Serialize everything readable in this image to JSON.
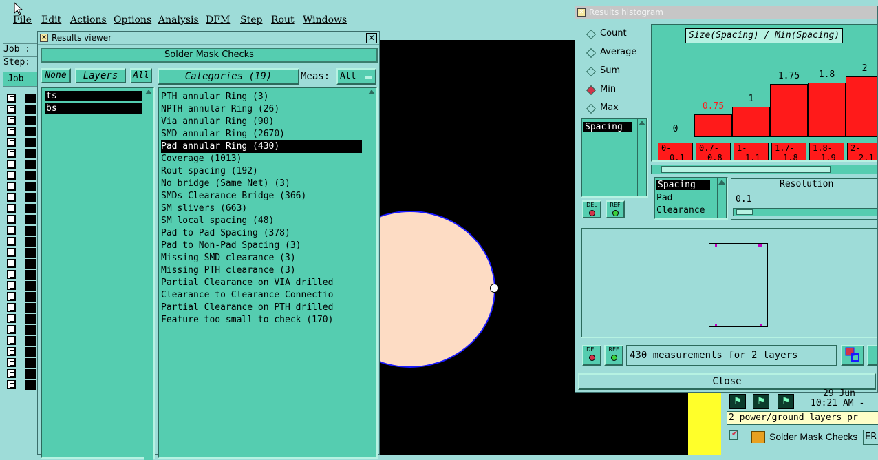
{
  "menu": {
    "items": [
      "File",
      "Edit",
      "Actions",
      "Options",
      "Analysis",
      "DFM",
      "Step",
      "Rout",
      "Windows"
    ]
  },
  "left_strip": {
    "job_label": "Job :",
    "step_label": "Step:",
    "job_button": "Job"
  },
  "results_viewer": {
    "title": "Results viewer",
    "header": "Solder Mask Checks",
    "none_button": "None",
    "layers_button": "Layers",
    "all_button": "All",
    "categories_button": "Categories (19)",
    "meas_label": "Meas:",
    "meas_value": "All",
    "layers": [
      "ts",
      "bs"
    ],
    "categories": [
      "PTH annular Ring (3)",
      "NPTH annular Ring (26)",
      "Via annular Ring (90)",
      "SMD annular Ring (2670)",
      "Pad annular Ring (430)",
      "Coverage (1013)",
      "Rout spacing (192)",
      "No bridge (Same Net) (3)",
      "SMDs Clearance Bridge (366)",
      "SM slivers (663)",
      "SM local spacing (48)",
      "Pad to Pad Spacing (378)",
      "Pad to Non-Pad Spacing (3)",
      "Missing SMD clearance (3)",
      "Missing PTH clearance (3)",
      "Partial Clearance on VIA drilled",
      "Clearance to Clearance Connectio",
      "Partial Clearance on PTH drilled",
      "Feature too small to check (170)"
    ],
    "selected_index": 4
  },
  "results_histogram": {
    "title": "Results histogram",
    "mode_options": [
      "Count",
      "Average",
      "Sum",
      "Min",
      "Max"
    ],
    "selected_mode": "Min",
    "list_selected": "Spacing",
    "chart_title": "Size(Spacing) / Min(Spacing)",
    "bar_values": [
      "0",
      "0.75",
      "1",
      "1.75",
      "1.8",
      "2"
    ],
    "bar_heights": [
      0,
      0.75,
      1,
      1.75,
      1.8,
      2
    ],
    "bins": [
      {
        "top": "0-",
        "bottom": "0.1"
      },
      {
        "top": "0.7-",
        "bottom": "0.8"
      },
      {
        "top": "1-",
        "bottom": "1.1"
      },
      {
        "top": "1.7-",
        "bottom": "1.8"
      },
      {
        "top": "1.8-",
        "bottom": "1.9"
      },
      {
        "top": "2-",
        "bottom": "2.1"
      }
    ],
    "attr_list": [
      "Spacing",
      "Pad",
      "Clearance"
    ],
    "resolution_label": "Resolution",
    "resolution_value": "0.1",
    "del_label": "DEL",
    "ref_label": "REF",
    "status": "430 measurements for 2 layers",
    "close_label": "Close",
    "colors": {
      "bar": "#ff1a1a",
      "panel": "#55cdb0",
      "background": "#9edcd8"
    }
  },
  "bottom_right": {
    "date": "29 Jun",
    "time": "10:21 AM -",
    "message": "2 power/ground layers pr",
    "check_name": "Solder Mask Checks",
    "er_label": "ER"
  }
}
